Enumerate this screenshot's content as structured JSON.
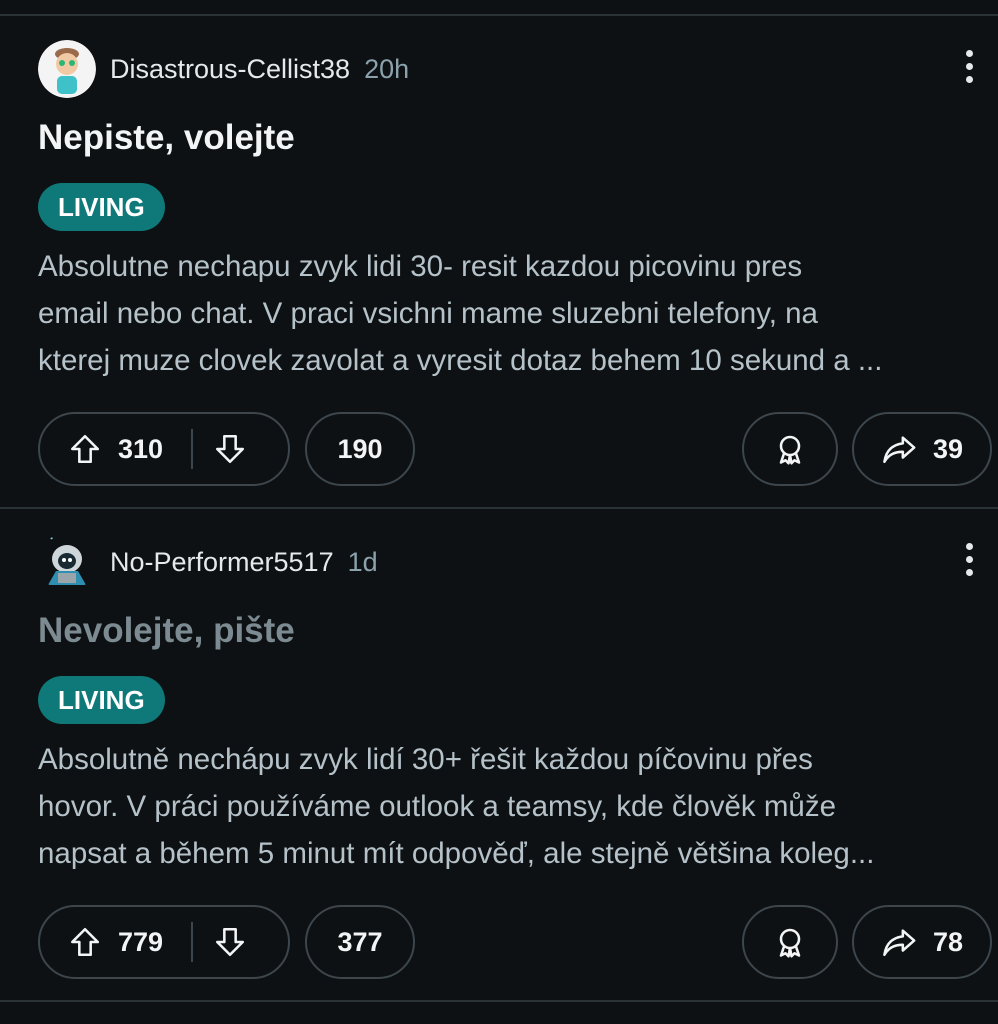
{
  "posts": [
    {
      "author": "Disastrous-Cellist38",
      "time": "20h",
      "title": "Nepiste, volejte",
      "flair": "LIVING",
      "body_lines": [
        "Absolutne nechapu zvyk lidi 30- resit kazdou picovinu pres",
        "email nebo chat. V praci vsichni mame sluzebni telefony, na",
        "kterej muze clovek zavolat a vyresit dotaz behem 10 sekund a ..."
      ],
      "upvotes": "310",
      "comments": "190",
      "shares": "39"
    },
    {
      "author": "No-Performer5517",
      "time": "1d",
      "title": "Nevolejte, pište",
      "flair": "LIVING",
      "body_lines": [
        "Absolutně nechápu zvyk lidí 30+ řešit každou píčovinu přes",
        "hovor. V práci používáme outlook a teamsy, kde člověk může",
        "napsat a během 5 minut mít odpověď, ale stejně většina koleg..."
      ],
      "upvotes": "779",
      "comments": "377",
      "shares": "78"
    }
  ],
  "colors": {
    "background": "#0e1113",
    "flair": "#0f7878",
    "divider": "#2a3236",
    "visited_title": "#7c8a91"
  },
  "icons": [
    "upvote-icon",
    "downvote-icon",
    "award-icon",
    "share-icon",
    "more-options-icon"
  ]
}
